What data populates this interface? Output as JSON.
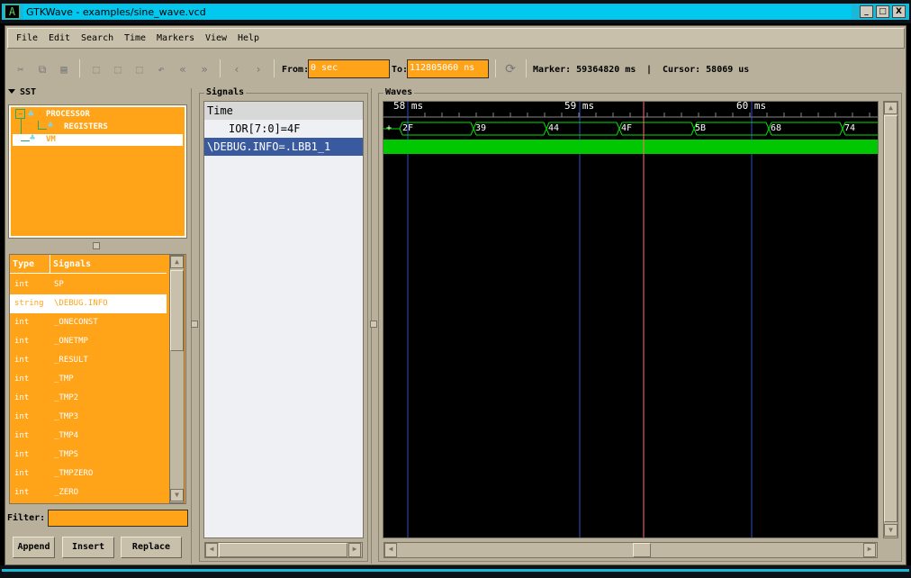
{
  "window": {
    "title": "GTKWave - examples/sine_wave.vcd",
    "icon_glyph": "A",
    "min": "_",
    "max": "□",
    "close": "X"
  },
  "menu": [
    "File",
    "Edit",
    "Search",
    "Time",
    "Markers",
    "View",
    "Help"
  ],
  "toolbar": {
    "from_label": "From:",
    "from_value": "0 sec",
    "to_label": "To:",
    "to_value": "112805060 ns",
    "marker_label": "Marker: 59364820 ms",
    "separator": "|",
    "cursor_label": "Cursor: 58069 us"
  },
  "sst": {
    "label": "SST",
    "tree": [
      "PROCESSOR",
      "REGISTERS",
      "VM"
    ],
    "columns": {
      "type": "Type",
      "signals": "Signals"
    },
    "rows": [
      {
        "type": "int",
        "name": "SP"
      },
      {
        "type": "string",
        "name": "\\DEBUG.INFO"
      },
      {
        "type": "int",
        "name": "_ONECONST"
      },
      {
        "type": "int",
        "name": "_ONETMP"
      },
      {
        "type": "int",
        "name": "_RESULT"
      },
      {
        "type": "int",
        "name": "_TMP"
      },
      {
        "type": "int",
        "name": "_TMP2"
      },
      {
        "type": "int",
        "name": "_TMP3"
      },
      {
        "type": "int",
        "name": "_TMP4"
      },
      {
        "type": "int",
        "name": "_TMPS"
      },
      {
        "type": "int",
        "name": "_TMPZERO"
      },
      {
        "type": "int",
        "name": "_ZERO"
      }
    ],
    "filter_label": "Filter:",
    "buttons": {
      "append": "Append",
      "insert": "Insert",
      "replace": "Replace"
    }
  },
  "signals": {
    "label": "Signals",
    "time_row": "Time",
    "row1": "IOR[7:0]=4F",
    "row2": "\\DEBUG.INFO=.LBB1_1"
  },
  "waves": {
    "label": "Waves",
    "ticks": [
      "58 ms",
      "59 ms",
      "60 ms"
    ],
    "plus": "+",
    "bus_values": [
      "2F",
      "39",
      "44",
      "4F",
      "5B",
      "68",
      "74"
    ]
  },
  "colors": {
    "accent": "#ffa318",
    "bus": "#00e000",
    "cursor": "#ff6060"
  }
}
